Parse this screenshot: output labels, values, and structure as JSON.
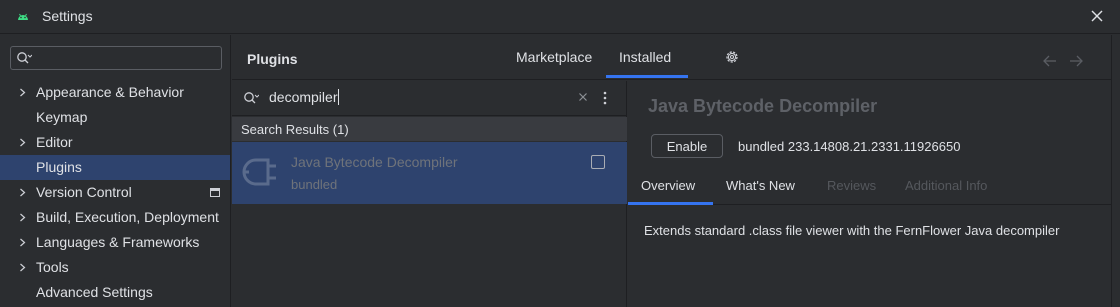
{
  "window": {
    "title": "Settings",
    "app_icon": "android-icon",
    "close_icon": "close-icon"
  },
  "sidebar": {
    "search": {
      "value": "",
      "placeholder": ""
    },
    "items": [
      {
        "label": "Appearance & Behavior",
        "expandable": true
      },
      {
        "label": "Keymap",
        "expandable": false
      },
      {
        "label": "Editor",
        "expandable": true
      },
      {
        "label": "Plugins",
        "expandable": false,
        "selected": true
      },
      {
        "label": "Version Control",
        "expandable": true,
        "badge_icon": "project-level-icon"
      },
      {
        "label": "Build, Execution, Deployment",
        "expandable": true
      },
      {
        "label": "Languages & Frameworks",
        "expandable": true
      },
      {
        "label": "Tools",
        "expandable": true
      },
      {
        "label": "Advanced Settings",
        "expandable": false
      }
    ]
  },
  "header": {
    "title": "Plugins",
    "tabs": [
      {
        "label": "Marketplace",
        "active": false
      },
      {
        "label": "Installed",
        "active": true
      }
    ],
    "gear_icon": "gear-icon",
    "nav": [
      "back-arrow-icon",
      "forward-arrow-icon"
    ]
  },
  "results": {
    "search_query": "decompiler",
    "header": "Search Results (1)",
    "plugins": [
      {
        "name": "Java Bytecode Decompiler",
        "subtitle": "bundled",
        "icon": "plugin-plug-icon",
        "enabled": false
      }
    ]
  },
  "details": {
    "name": "Java Bytecode Decompiler",
    "enable_label": "Enable",
    "version": "bundled 233.14808.21.2331.11926650",
    "tabs": [
      {
        "label": "Overview",
        "active": true,
        "enabled": true
      },
      {
        "label": "What's New",
        "active": false,
        "enabled": true
      },
      {
        "label": "Reviews",
        "active": false,
        "enabled": false
      },
      {
        "label": "Additional Info",
        "active": false,
        "enabled": false
      }
    ],
    "description": "Extends standard .class file viewer with the FernFlower Java decompiler"
  },
  "colors": {
    "background": "#2b2d30",
    "selection": "#2e436e",
    "accent": "#3574f0",
    "text": "#dfe1e5",
    "muted_text": "#6f737a"
  }
}
